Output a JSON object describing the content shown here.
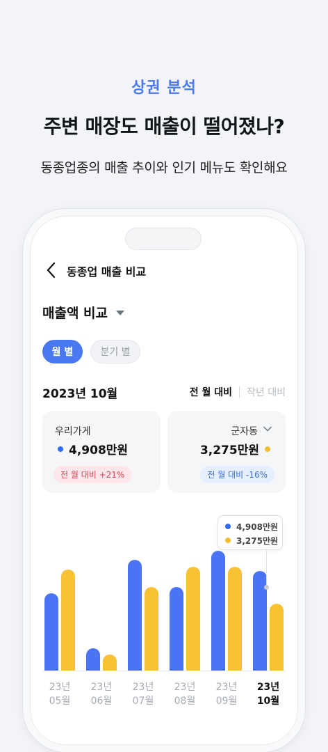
{
  "promo": {
    "eyebrow": "상권 분석",
    "title": "주변 매장도 매출이 떨어졌나?",
    "subtitle": "동종업종의 매출 추이와 인기 메뉴도 확인해요"
  },
  "screen": {
    "nav_title": "동종업 매출 비교",
    "metric_select": "매출액 비교",
    "period_tabs": [
      {
        "label": "월 별",
        "active": true
      },
      {
        "label": "분기 별",
        "active": false
      }
    ],
    "date": "2023년 10월",
    "compare_options": [
      "전 월 대비",
      "작년 대비"
    ],
    "my_store": {
      "name": "우리가게",
      "value": "4,908만원",
      "change": "전 월 대비 +21%"
    },
    "region": {
      "name": "군자동",
      "value": "3,275만원",
      "change": "전 월 대비 -16%"
    },
    "tooltip": [
      "4,908만원",
      "3,275만원"
    ]
  },
  "colors": {
    "accent": "#4a78f0",
    "my_store": "#4a74f3",
    "region": "#f8c234",
    "up": "#e04355",
    "down": "#3b6fd8"
  },
  "chart_data": {
    "type": "bar",
    "categories": [
      "23년\n05월",
      "23년\n06월",
      "23년\n07월",
      "23년\n08월",
      "23년\n09월",
      "23년\n10월"
    ],
    "series": [
      {
        "values": [
          3800,
          1100,
          5450,
          4100,
          5900,
          4908
        ],
        "color": "#4a74f3"
      },
      {
        "values": [
          4950,
          800,
          4100,
          5100,
          5100,
          3275
        ],
        "color": "#f8c234"
      }
    ],
    "selected_index": 5,
    "ylim": [
      0,
      6500
    ],
    "grid": false,
    "legend": "none"
  }
}
